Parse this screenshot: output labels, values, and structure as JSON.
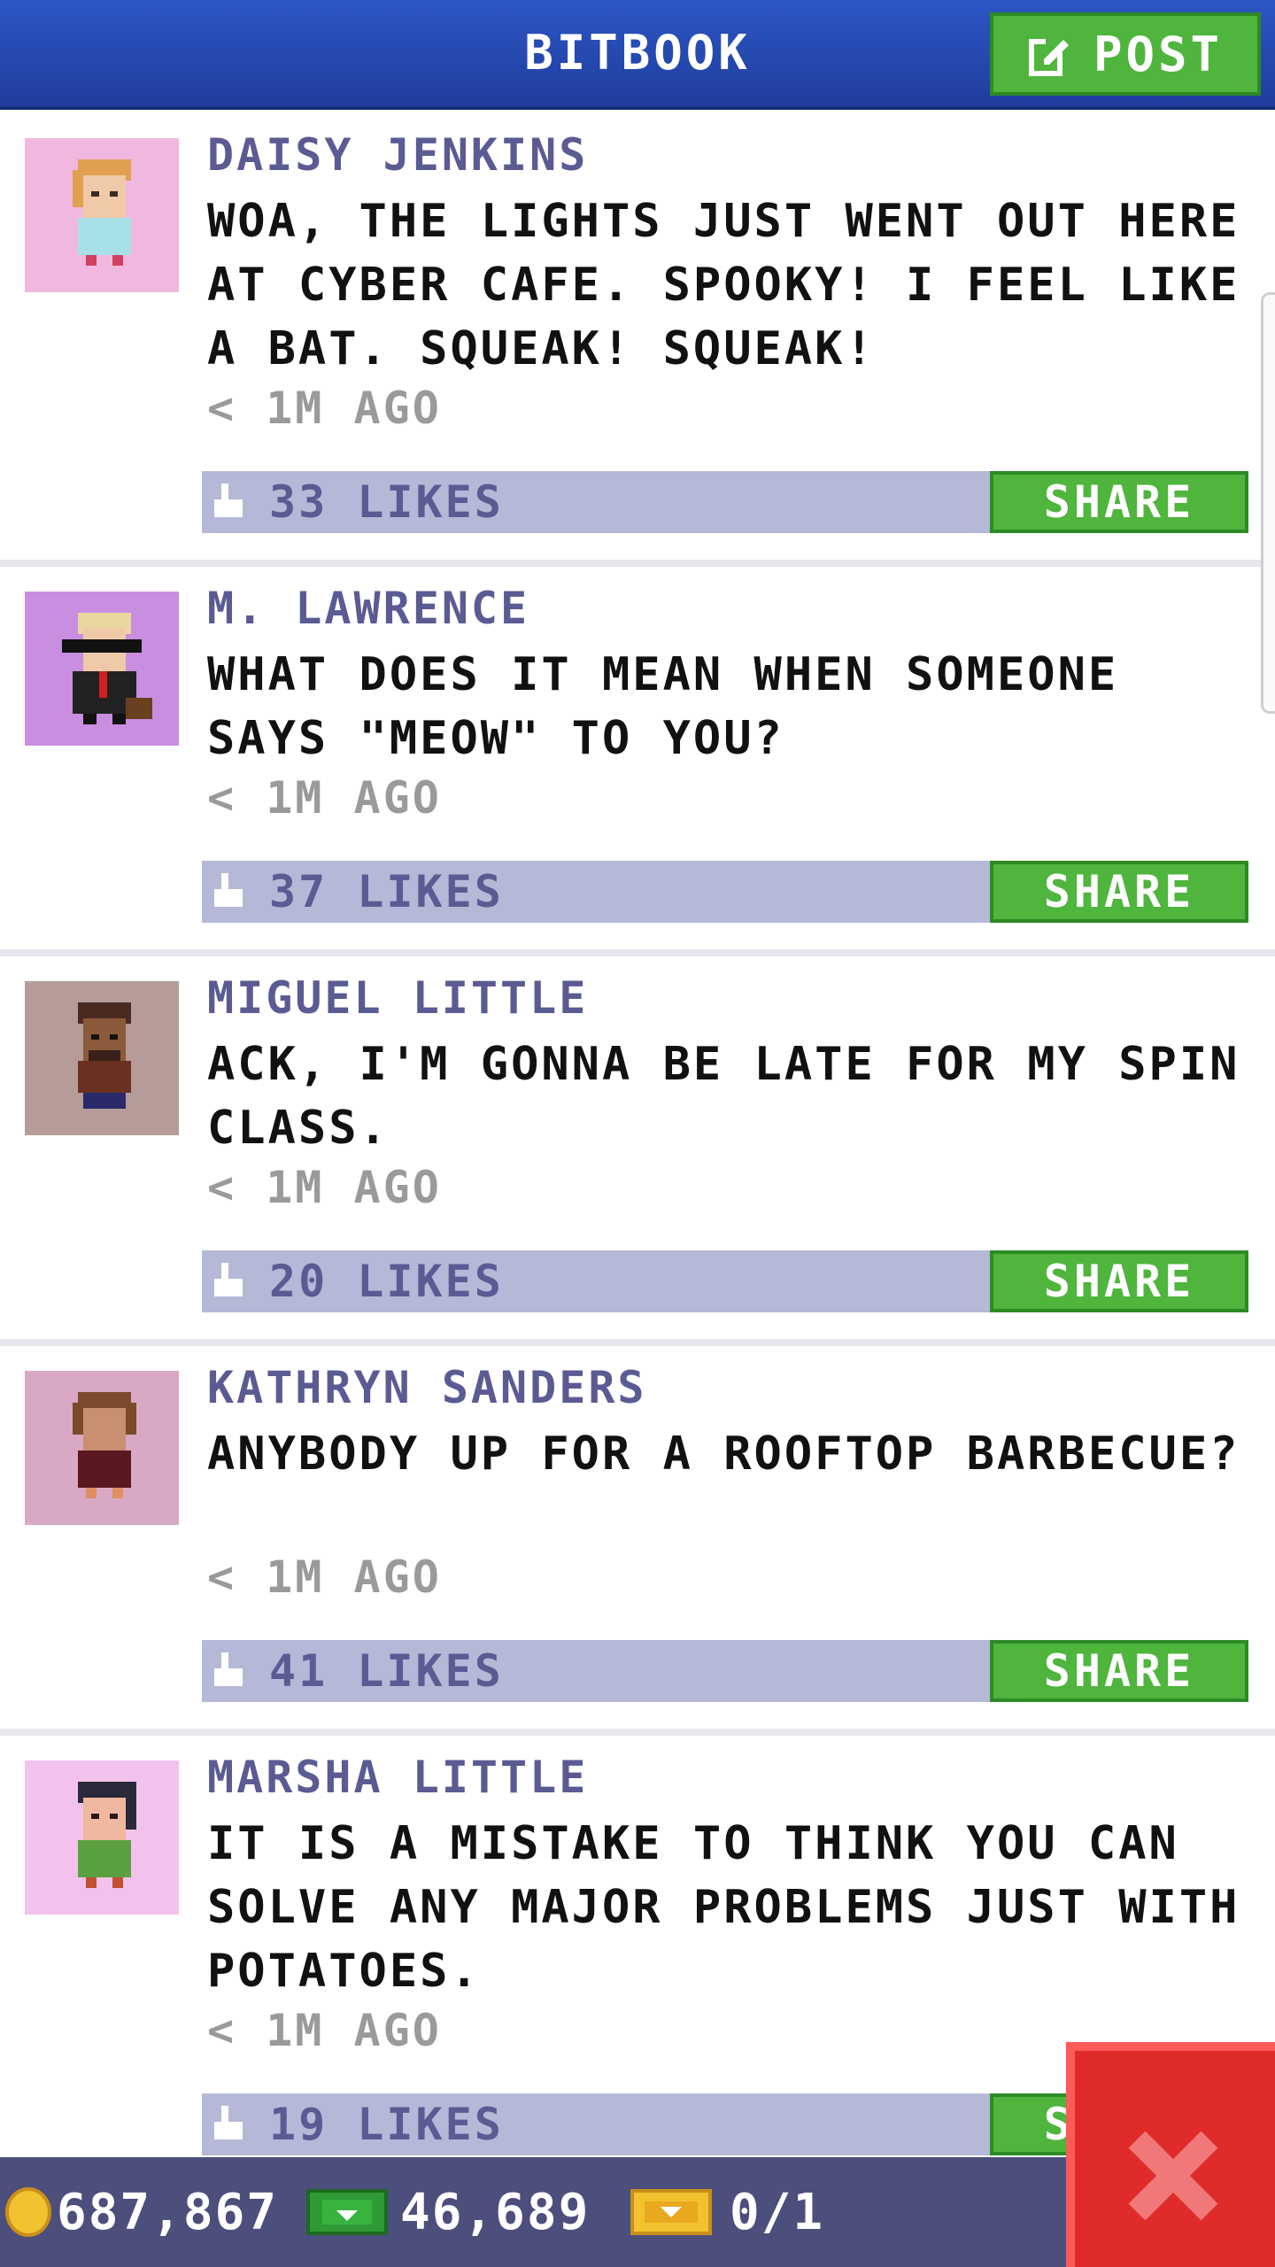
{
  "header": {
    "title": "BITBOOK",
    "post_label": "POST"
  },
  "posts": [
    {
      "author": "DAISY JENKINS",
      "message": "WOA, THE LIGHTS JUST WENT OUT HERE AT CYBER CAFE. SPOOKY! I FEEL LIKE A BAT. SQUEAK! SQUEAK!",
      "time": "< 1M AGO",
      "likes": "33 LIKES",
      "share_label": "SHARE",
      "avatar_bg": "#f0b8de"
    },
    {
      "author": "M. LAWRENCE",
      "message": "WHAT DOES IT MEAN WHEN SOMEONE SAYS \"MEOW\" TO YOU?",
      "time": "< 1M AGO",
      "likes": "37 LIKES",
      "share_label": "SHARE",
      "avatar_bg": "#c98ee0"
    },
    {
      "author": "MIGUEL LITTLE",
      "message": "ACK, I'M GONNA BE LATE FOR MY SPIN CLASS.",
      "time": "< 1M AGO",
      "likes": "20 LIKES",
      "share_label": "SHARE",
      "avatar_bg": "#b59c98"
    },
    {
      "author": "KATHRYN SANDERS",
      "message": "ANYBODY UP FOR A ROOFTOP BARBECUE?",
      "time": "< 1M AGO",
      "likes": "41 LIKES",
      "share_label": "SHARE",
      "avatar_bg": "#d9a8c4"
    },
    {
      "author": "MARSHA LITTLE",
      "message": "IT IS A MISTAKE TO THINK YOU CAN SOLVE ANY MAJOR PROBLEMS JUST WITH POTATOES.",
      "time": "< 1M AGO",
      "likes": "19 LIKES",
      "share_label": "SHARE",
      "avatar_bg": "#f3c2ec"
    }
  ],
  "footer": {
    "coins": "687,867",
    "bux": "46,689",
    "tickets": "0/1"
  },
  "colors": {
    "header_blue": "#2d56c4",
    "accent_green": "#4fb53d",
    "likes_bar": "#b6b8d8",
    "name_purple": "#5b5b93",
    "close_red": "#e02b2b"
  },
  "icons": [
    "post-edit-icon",
    "thumbs-up-icon",
    "coin-icon",
    "bux-icon",
    "ticket-icon",
    "close-icon"
  ]
}
